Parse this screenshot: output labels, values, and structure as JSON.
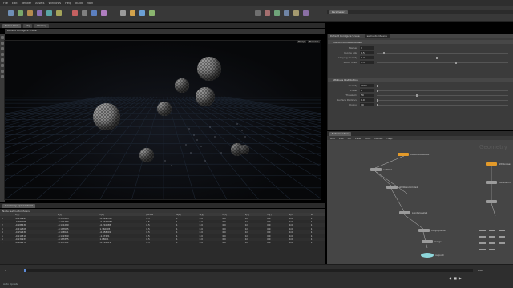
{
  "menu": [
    "File",
    "Edit",
    "Render",
    "Assets",
    "Windows",
    "Help",
    "Build",
    "Main"
  ],
  "viewport": {
    "tab_label": "Scene View",
    "path_label": "obj",
    "context_label": "Working",
    "header_label": "Default Configure Scene",
    "persp_label": "Persp",
    "cam_label": "No cam"
  },
  "params": {
    "tab_label": "Parameters",
    "node_label": "Default Configure Scene",
    "node_name": "setCustomScene",
    "section1": "Custom Point Attributes",
    "section2": "Attribute Distribution",
    "rows1": [
      {
        "label": "Names",
        "value": "1"
      },
      {
        "label": "Pscale Size",
        "value": "0.5",
        "pos": 5
      },
      {
        "label": "Varying Density",
        "value": "0.4",
        "pos": 45
      },
      {
        "label": "Initial Scale",
        "value": "1.5",
        "pos": 60
      }
    ],
    "rows2": [
      {
        "label": "Density",
        "value": "1000",
        "pos": 0
      },
      {
        "label": "Phase",
        "value": "0",
        "pos": 0
      },
      {
        "label": "Threshold",
        "value": "50",
        "pos": 30
      },
      {
        "label": "Surface Distance",
        "value": "0.0",
        "pos": 0
      },
      {
        "label": "Output",
        "value": "10",
        "pos": 0
      }
    ]
  },
  "network": {
    "tab_label": "Network View",
    "menu": [
      "Add",
      "Edit",
      "Go",
      "View",
      "Tools",
      "Layout",
      "Help"
    ],
    "nodes": [
      {
        "label": "customAttribute1",
        "type": "orange"
      },
      {
        "label": "scatter1",
        "type": "gray"
      },
      {
        "label": "attribrandomize1",
        "type": "gray"
      },
      {
        "label": "pointwrangle1",
        "type": "gray"
      },
      {
        "label": "copytopoints1",
        "type": "gray"
      },
      {
        "label": "merge1",
        "type": "gray"
      },
      {
        "label": "output0",
        "type": "cyan"
      },
      {
        "label": "attribnoise1",
        "type": "orange"
      },
      {
        "label": "transform1",
        "type": "gray"
      }
    ],
    "watermark": "Geometry"
  },
  "spreadsheet": {
    "tab_label": "Geometry Spreadsheet",
    "node_label": "Node: setCustomScene",
    "columns": [
      "",
      "P[x]",
      "P[y]",
      "P[z]",
      "pscale",
      "N[x]",
      "N[y]",
      "N[z]",
      "v[x]",
      "v[y]",
      "v[z]",
      "id"
    ],
    "rows": [
      [
        "0",
        "-0.136945",
        "-0.373525",
        "-0.8992337",
        "0.5",
        "1",
        "0.0",
        "0.0",
        "0.0",
        "0.0",
        "0.0",
        "1"
      ],
      [
        "1",
        "-0.284065",
        "-0.191453",
        "-0.3327756",
        "0.5",
        "1",
        "0.0",
        "0.0",
        "0.0",
        "0.0",
        "0.0",
        "1"
      ],
      [
        "2",
        "-0.188431",
        "-0.141289",
        "-0.210085",
        "0.5",
        "1",
        "0.0",
        "0.0",
        "0.0",
        "0.0",
        "0.0",
        "1"
      ],
      [
        "3",
        "-0.212508",
        "-0.163585",
        "1.360095",
        "0.5",
        "1",
        "0.0",
        "0.0",
        "0.0",
        "0.0",
        "0.0",
        "1"
      ],
      [
        "4",
        "-0.152431",
        "-0.196521",
        "-0.458091",
        "0.5",
        "1",
        "0.0",
        "0.0",
        "0.0",
        "0.0",
        "0.0",
        "1"
      ],
      [
        "5",
        "-0.119511",
        "-0.142309",
        "-1.07221",
        "0.5",
        "1",
        "0.0",
        "0.0",
        "0.0",
        "0.0",
        "0.0",
        "1"
      ],
      [
        "6",
        "-0.130933",
        "-0.183355",
        "1.08001",
        "0.5",
        "1",
        "0.0",
        "0.0",
        "0.0",
        "0.0",
        "0.0",
        "1"
      ],
      [
        "7",
        "-0.102171",
        "-0.147281",
        "-0.118311",
        "0.5",
        "1",
        "0.0",
        "0.0",
        "0.0",
        "0.0",
        "0.0",
        "1"
      ]
    ]
  },
  "timeline": {
    "frame_start": "1",
    "frame_end": "240",
    "current_frame": "1",
    "status": "Auto Update"
  }
}
